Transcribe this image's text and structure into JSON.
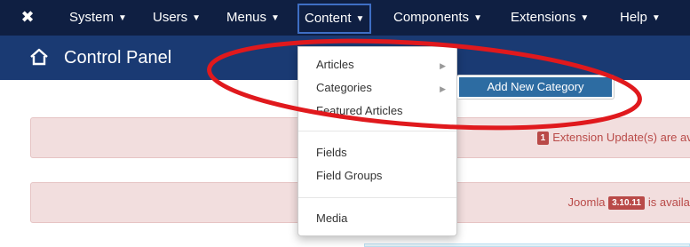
{
  "navbar": {
    "logo_icon": "joomla-logo-icon",
    "items": [
      {
        "label": "System"
      },
      {
        "label": "Users"
      },
      {
        "label": "Menus"
      },
      {
        "label": "Content"
      },
      {
        "label": "Components"
      },
      {
        "label": "Extensions"
      },
      {
        "label": "Help"
      }
    ],
    "active_item": "Content"
  },
  "header": {
    "icon": "home-icon",
    "title": "Control Panel"
  },
  "dropdown": {
    "items": [
      {
        "label": "Articles",
        "has_submenu": true
      },
      {
        "label": "Categories",
        "has_submenu": true
      },
      {
        "label": "Featured Articles",
        "has_submenu": false
      },
      {
        "label": "Fields",
        "has_submenu": false
      },
      {
        "label": "Field Groups",
        "has_submenu": false
      },
      {
        "label": "Media",
        "has_submenu": false
      }
    ],
    "submenu_item": "Add New Category"
  },
  "alerts": [
    {
      "badge": "1",
      "text": "Extension Update(s) are ava"
    },
    {
      "prefix": "Joomla",
      "badge": "3.10.11",
      "text": "is availabl"
    }
  ],
  "colors": {
    "navbar_bg": "#0f1f42",
    "header_bg": "#1a3a73",
    "alert_bg": "#f2dede",
    "alert_text": "#b94a48",
    "submenu_highlight": "#2d6ca2",
    "annotation_red": "#e0191d"
  }
}
